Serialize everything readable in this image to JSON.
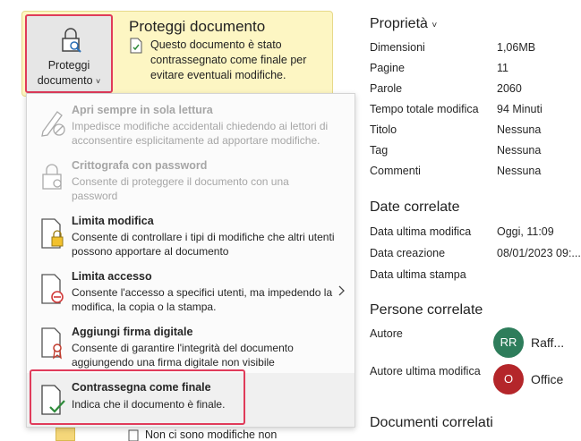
{
  "protect": {
    "button_line1": "Proteggi",
    "button_line2": "documento",
    "chevron": "˅",
    "title": "Proteggi documento",
    "description": "Questo documento è stato contrassegnato come finale per evitare eventuali modifiche."
  },
  "menu": {
    "items": [
      {
        "title": "Apri sempre in sola lettura",
        "desc": "Impedisce modifiche accidentali chiedendo ai lettori di acconsentire esplicitamente ad apportare modifiche.",
        "icon": "pencil-block-icon",
        "enabled": false
      },
      {
        "title": "Crittografa con password",
        "desc": "Consente di proteggere il documento con una password",
        "icon": "lock-key-icon",
        "enabled": false
      },
      {
        "title": "Limita modifica",
        "desc": "Consente di controllare i tipi di modifiche che altri utenti possono apportare al documento",
        "icon": "document-lock-icon",
        "enabled": true
      },
      {
        "title": "Limita accesso",
        "desc": "Consente l'accesso a specifici utenti, ma impedendo la modifica, la copia o la stampa.",
        "icon": "document-restrict-icon",
        "enabled": true
      },
      {
        "title": "Aggiungi firma digitale",
        "desc": "Consente di garantire l'integrità del documento aggiungendo una firma digitale non visibile",
        "icon": "document-ribbon-icon",
        "enabled": true
      },
      {
        "title": "Contrassegna come finale",
        "desc": "Indica che il documento è finale.",
        "icon": "document-check-icon",
        "enabled": true
      }
    ],
    "submenu_arrow": "›"
  },
  "peek": {
    "text": "Non ci sono modifiche non"
  },
  "properties": {
    "title": "Proprietà",
    "chevron": "˅",
    "rows": [
      {
        "label": "Dimensioni",
        "value": "1,06MB"
      },
      {
        "label": "Pagine",
        "value": "11"
      },
      {
        "label": "Parole",
        "value": "2060"
      },
      {
        "label": "Tempo totale modifica",
        "value": "94 Minuti"
      },
      {
        "label": "Titolo",
        "value": "Nessuna"
      },
      {
        "label": "Tag",
        "value": "Nessuna"
      },
      {
        "label": "Commenti",
        "value": "Nessuna"
      }
    ]
  },
  "dates": {
    "title": "Date correlate",
    "rows": [
      {
        "label": "Data ultima modifica",
        "value": "Oggi, 11:09"
      },
      {
        "label": "Data creazione",
        "value": "08/01/2023 09:..."
      },
      {
        "label": "Data ultima stampa",
        "value": ""
      }
    ]
  },
  "people": {
    "title": "Persone correlate",
    "author_label": "Autore",
    "author_initials": "RR",
    "author_name": "Raff...",
    "author_color": "#2e7d5b",
    "last_modified_label": "Autore ultima modifica",
    "last_modified_initials": "O",
    "last_modified_name": "Office",
    "last_modified_color": "#b4262a"
  },
  "related_docs": {
    "title": "Documenti correlati"
  }
}
